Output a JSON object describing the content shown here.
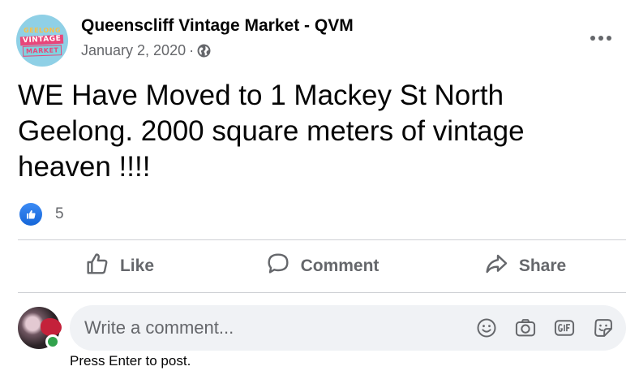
{
  "page": {
    "name": "Queenscliff Vintage Market - QVM",
    "logo_lines": [
      "GEELONG",
      "VINTAGE",
      "MARKET"
    ],
    "date": "January 2, 2020",
    "separator": "·",
    "privacy_icon": "globe-icon",
    "menu_icon": "more-options-icon"
  },
  "post": {
    "text": "WE Have Moved to 1 Mackey St North Geelong. 2000 square meters of vintage heaven !!!!"
  },
  "reactions": {
    "icon": "like-reaction-icon",
    "count": "5"
  },
  "actions": [
    {
      "label": "Like",
      "icon": "thumbs-up-icon"
    },
    {
      "label": "Comment",
      "icon": "comment-bubble-icon"
    },
    {
      "label": "Share",
      "icon": "share-arrow-icon"
    }
  ],
  "comment": {
    "placeholder": "Write a comment...",
    "icons": [
      "emoji-icon",
      "camera-icon",
      "gif-icon",
      "sticker-icon"
    ],
    "hint": "Press Enter to post."
  },
  "colors": {
    "brand_blue": "#1877f2",
    "secondary_text": "#65676b",
    "online_green": "#31a24c",
    "input_bg": "#f0f2f5"
  }
}
